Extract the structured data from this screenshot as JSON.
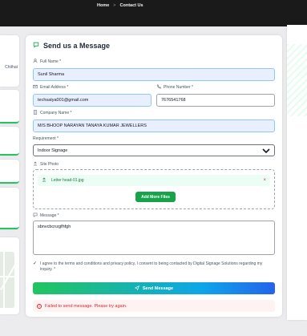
{
  "breadcrumb": {
    "home": "Home",
    "separator": ">",
    "current": "Contact Us"
  },
  "left_panel": {
    "clipped_text": "Chithat"
  },
  "form": {
    "title": "Send us a Message",
    "full_name": {
      "label": "Full Name *",
      "value": "Sunil Sharma"
    },
    "email": {
      "label": "Email Address *",
      "value": "techsatya001@gmail.com"
    },
    "phone": {
      "label": "Phone Number *",
      "value": "7676541768"
    },
    "company": {
      "label": "Company Name *",
      "value": "M/S BHOOP NARAYAN TANAYA KUMAR JEWELLERS"
    },
    "requirement": {
      "label": "Requirement *",
      "value": "Indoor Signage"
    },
    "site_photo": {
      "label": "Site Photo",
      "file_name": "Letter head-01.jpg",
      "remove": "×",
      "add_more": "Add More Files"
    },
    "message": {
      "label": "Message *",
      "value": "sbnvcbcnzgfhfgh"
    },
    "consent": "I agree to the terms and conditions and privacy policy, I consent to being contacted by Digital Signage Solutions regarding my inquiry. *",
    "submit": "Send Message",
    "error": "Failed to send message. Please try again."
  },
  "icons": {
    "title": "message-square-icon",
    "user": "user-icon",
    "mail": "mail-icon",
    "phone": "phone-icon",
    "building": "building-icon",
    "upload": "upload-icon",
    "chat": "chat-icon",
    "send": "send-icon",
    "alert": "alert-circle-icon"
  },
  "colors": {
    "accent_green": "#16a34a",
    "error_red": "#dc2626",
    "autofill_blue": "#e8f0fe"
  }
}
